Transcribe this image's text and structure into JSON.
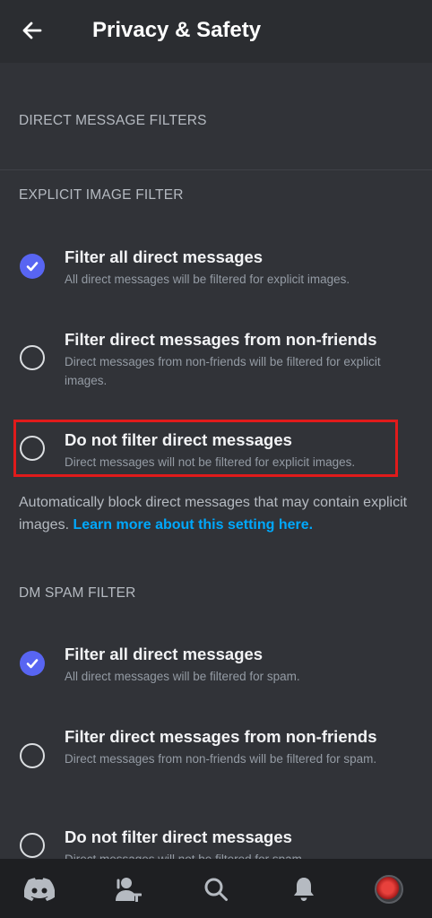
{
  "header": {
    "title": "Privacy & Safety",
    "back_icon": "arrow-left-icon"
  },
  "sections": {
    "dm_filters": "DIRECT MESSAGE FILTERS",
    "explicit": "EXPLICIT IMAGE FILTER",
    "spam": "DM SPAM FILTER"
  },
  "explicit_options": [
    {
      "title": "Filter all direct messages",
      "desc": "All direct messages will be filtered for explicit images.",
      "selected": true
    },
    {
      "title": "Filter direct messages from non-friends",
      "desc": "Direct messages from non-friends will be filtered for explicit images.",
      "selected": false
    },
    {
      "title": "Do not filter direct messages",
      "desc": "Direct messages will not be filtered for explicit images.",
      "selected": false
    }
  ],
  "helper": {
    "text": "Automatically block direct messages that may contain explicit images.",
    "link": "Learn more about this setting here."
  },
  "spam_options": [
    {
      "title": "Filter all direct messages",
      "desc": "All direct messages will be filtered for spam.",
      "selected": true
    },
    {
      "title": "Filter direct messages from non-friends",
      "desc": "Direct messages from non-friends will be filtered for spam.",
      "selected": false
    },
    {
      "title": "Do not filter direct messages",
      "desc": "Direct messages will not be filtered for spam.",
      "selected": false
    }
  ],
  "bottom_nav": [
    {
      "name": "home",
      "icon": "discord-icon"
    },
    {
      "name": "friends",
      "icon": "friends-icon"
    },
    {
      "name": "search",
      "icon": "search-icon"
    },
    {
      "name": "notifications",
      "icon": "bell-icon"
    },
    {
      "name": "profile",
      "icon": "avatar"
    }
  ],
  "colors": {
    "background": "#313338",
    "header": "#2b2d31",
    "accent": "#5865f2",
    "link": "#00a8fc",
    "highlight": "#e01b1b"
  }
}
